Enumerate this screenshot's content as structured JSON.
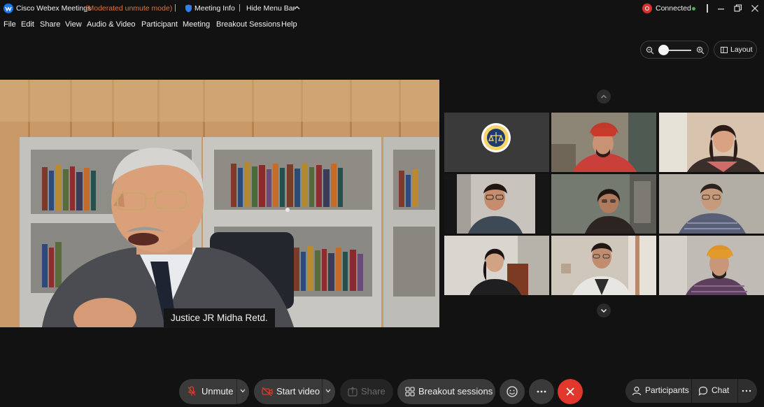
{
  "titlebar": {
    "app_title": "Cisco Webex Meetings",
    "mode": "(Moderated unmute mode)",
    "separator": "|",
    "meeting_info": "Meeting Info",
    "hide_menu_bar": "Hide Menu Bar",
    "connection_status": "Connected",
    "recording_color": "#d6352f",
    "connected_color": "#4caf50"
  },
  "menu": [
    "File",
    "Edit",
    "Share",
    "View",
    "Audio & Video",
    "Participant",
    "Meeting",
    "Breakout Sessions",
    "Help"
  ],
  "view_controls": {
    "zoom_level": 0.2,
    "layout_label": "Layout"
  },
  "main_speaker": {
    "name": "Justice JR Midha Retd."
  },
  "grid": {
    "tiles": [
      {
        "id": "logo",
        "kind": "logo"
      },
      {
        "id": "p1",
        "kind": "video"
      },
      {
        "id": "p2",
        "kind": "video"
      },
      {
        "id": "p3",
        "kind": "video"
      },
      {
        "id": "p4",
        "kind": "video"
      },
      {
        "id": "p5",
        "kind": "video"
      },
      {
        "id": "p6",
        "kind": "video"
      },
      {
        "id": "p7",
        "kind": "video"
      },
      {
        "id": "p8",
        "kind": "video"
      }
    ]
  },
  "controls": {
    "unmute": "Unmute",
    "start_video": "Start video",
    "share": "Share",
    "breakout": "Breakout sessions",
    "participants": "Participants",
    "chat": "Chat",
    "accent_red": "#e2372c"
  }
}
